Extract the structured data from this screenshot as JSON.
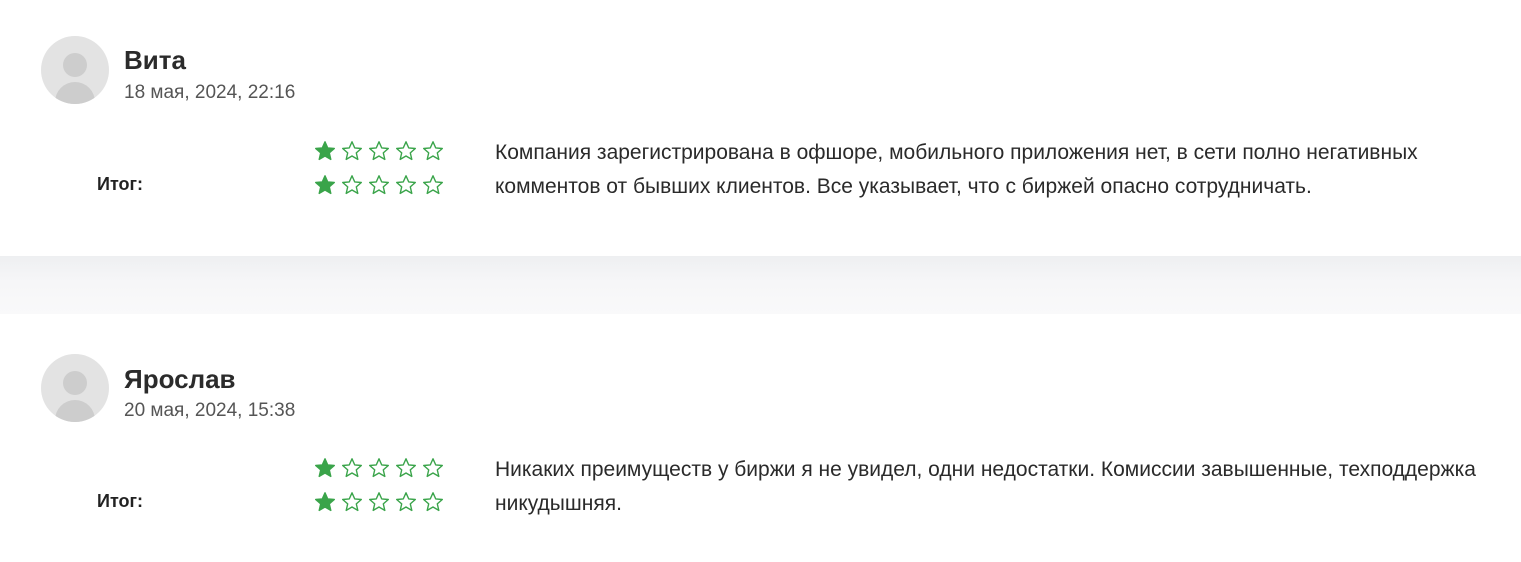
{
  "reviews": [
    {
      "author": "Вита",
      "date": "18 мая, 2024, 22:16",
      "summary_label": "Итог:",
      "ratings": [
        1,
        1
      ],
      "max_rating": 5,
      "comment": "Компания зарегистрирована в офшоре, мобильного приложения нет, в сети полно негативных комментов от бывших клиентов. Все указывает, что с биржей опасно сотрудничать."
    },
    {
      "author": "Ярослав",
      "date": "20 мая, 2024, 15:38",
      "summary_label": "Итог:",
      "ratings": [
        1,
        1
      ],
      "max_rating": 5,
      "comment": "Никаких преимуществ у биржи я не увидел, одни недостатки. Комиссии завышенные, техподдержка никудышняя."
    }
  ],
  "colors": {
    "star": "#3aa44a",
    "avatar_bg": "#e3e3e3",
    "avatar_fg": "#cdcdcd",
    "separator": "#f3f3f5"
  },
  "icons": {
    "avatar": "user-avatar-icon",
    "filled_star": "star-filled-icon",
    "empty_star": "star-outline-icon"
  }
}
